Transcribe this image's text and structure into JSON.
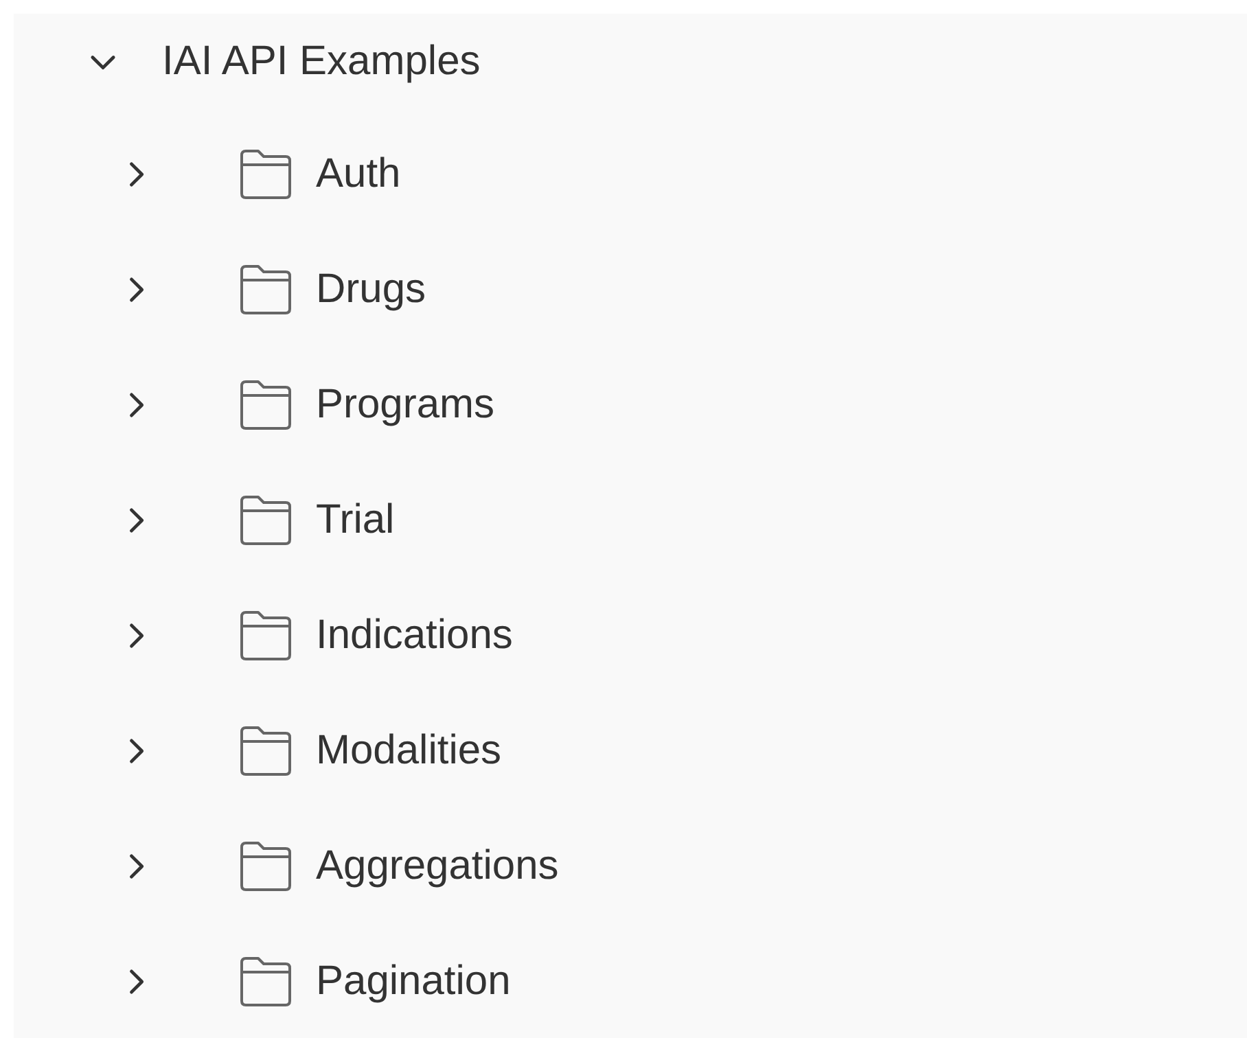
{
  "tree": [
    {
      "label": "IAI API Examples",
      "expanded": true,
      "children": [
        {
          "label": "Auth",
          "expanded": false
        },
        {
          "label": "Drugs",
          "expanded": false
        },
        {
          "label": "Programs",
          "expanded": false
        },
        {
          "label": "Trial",
          "expanded": false
        },
        {
          "label": "Indications",
          "expanded": false
        },
        {
          "label": "Modalities",
          "expanded": false
        },
        {
          "label": "Aggregations",
          "expanded": false
        },
        {
          "label": "Pagination",
          "expanded": false
        }
      ]
    }
  ]
}
